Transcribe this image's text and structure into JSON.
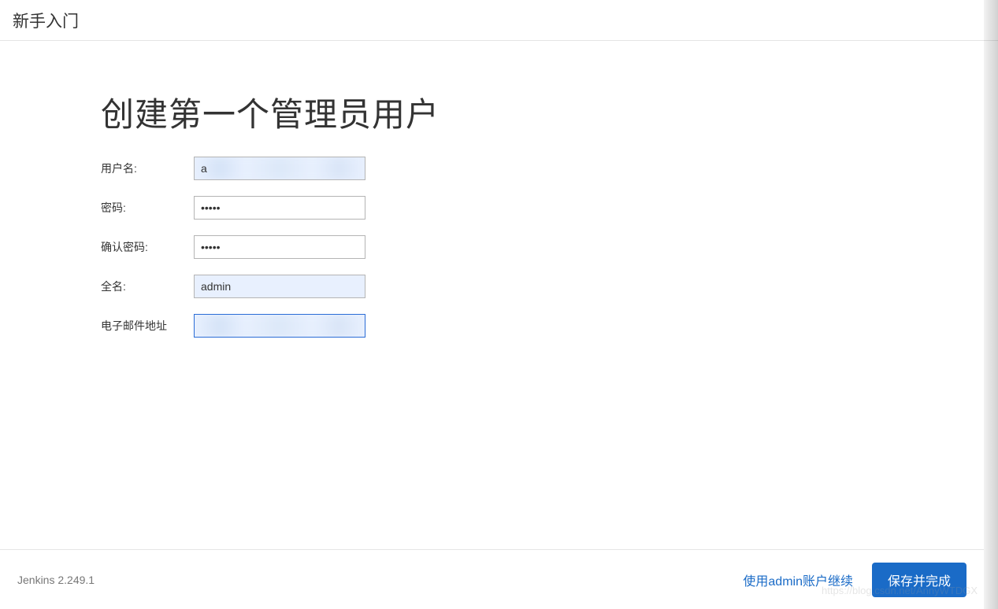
{
  "header": {
    "title": "新手入门"
  },
  "page": {
    "title": "创建第一个管理员用户"
  },
  "form": {
    "username": {
      "label": "用户名:",
      "value": "a"
    },
    "password": {
      "label": "密码:",
      "value": "•••••"
    },
    "confirm_password": {
      "label": "确认密码:",
      "value": "•••••"
    },
    "fullname": {
      "label": "全名:",
      "value": "admin"
    },
    "email": {
      "label": "电子邮件地址",
      "value": ""
    }
  },
  "footer": {
    "version": "Jenkins 2.249.1",
    "continue_as_admin": "使用admin账户继续",
    "save_and_finish": "保存并完成"
  },
  "watermark": "https://blog.csdn.net/AnnyWTDGX"
}
